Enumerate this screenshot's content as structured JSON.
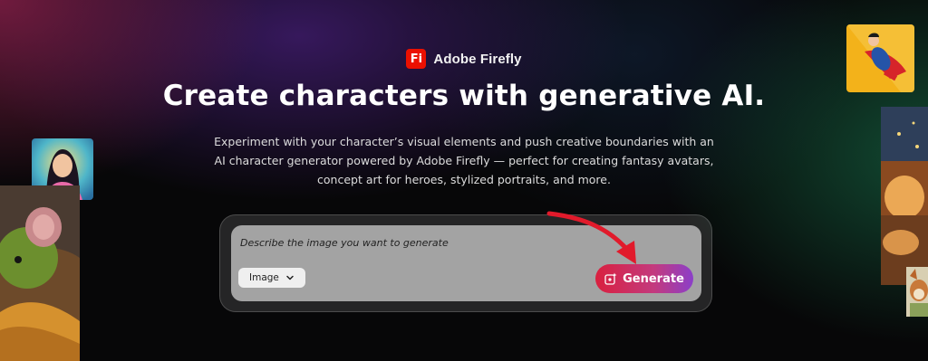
{
  "brand": {
    "logo_text": "Fi",
    "name": "Adobe Firefly"
  },
  "headline": "Create characters with generative AI.",
  "subtext": "Experiment with your character’s visual elements and push creative boundaries with an AI character generator powered by Adobe Firefly — perfect for creating fantasy avatars, concept art for heroes, stylized portraits, and more.",
  "prompt": {
    "placeholder": "Describe the image you want to generate",
    "image_button_label": "Image",
    "generate_label": "Generate"
  },
  "icons": {
    "chevron": "chevron-down-icon",
    "generate": "sparkle-image-icon",
    "annotation": "red-arrow-icon"
  },
  "colors": {
    "brand_red": "#eb1000",
    "generate_gradient_start": "#d9203f",
    "generate_gradient_end": "#8b3fc9"
  }
}
